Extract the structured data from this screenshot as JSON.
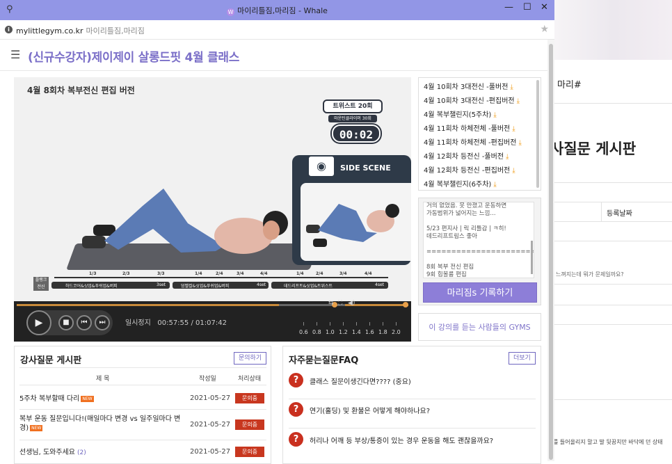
{
  "window": {
    "title": "마이리틀짐,마리짐 - Whale",
    "url": "mylittlegym.co.kr",
    "url_title": "마이리틀짐,마리짐"
  },
  "page": {
    "title": "(신규수강자)제이제이 살롱드핏 4월 클래스"
  },
  "video": {
    "caption": "4월 8회차 복부전신 편집 버전",
    "count_label": "트위스트 20회",
    "count_sub": "마운틴클라이머 30회",
    "timer": "00:02",
    "side_scene": "SIDE SCENE",
    "timeline_label": "플랭크 전신",
    "timeline_marks": [
      "1/3",
      "2/3",
      "3/3",
      "1/4",
      "2/4",
      "3/4",
      "4/4",
      "1/4",
      "2/4",
      "3/4",
      "4/4"
    ],
    "segments": [
      "하드코어&싯업&푸쉬업&버피",
      "3set",
      "덤벨컬&싯업&푸쉬업&버피",
      "4set",
      "데드리프트&싯업&트위스트",
      "4set"
    ],
    "status": "일시정지",
    "time_current": "00:57:55",
    "time_total": "01:07:42",
    "speeds": [
      "0.6",
      "0.8",
      "1.0",
      "1.2",
      "1.4",
      "1.6",
      "1.8",
      "2.0"
    ],
    "progress_fraction": 0.86
  },
  "clips": [
    "4월 10회차 3대전신 -풀버전",
    "4월 10회차 3대전신 -편집버전",
    "4월 복부챌린지(5주차)",
    "4월 11회차 하체전체 -풀버전",
    "4월 11회차 하체전체 -편집버전",
    "4월 12회차 등전신 -풀버전",
    "4월 12회차 등전신 -편집버전",
    "4월 복부챌린지(6주차)"
  ],
  "memo": {
    "text": "거의 없었음. 못 만졌고 운동하면\n가동범위가 넓어지는 느낌...\n\n5/23 편지사 | 릭 리틀감 | ㅋ히!\n데드리프트림스 좋아\n\n=======================\n\n8회 복부 전신 편집\n9회 힙볼륨 편집",
    "button": "마리짐s 기록하기"
  },
  "gyms_link": "이 강의를 듣는 사람들의 GYMS",
  "qa": {
    "title": "강사질문 게시판",
    "ask_button": "문의하기",
    "columns": [
      "제 목",
      "작성일",
      "처리상태"
    ],
    "rows": [
      {
        "title": "5주차 복부할때 다리",
        "new": "NEW",
        "count": "",
        "date": "2021-05-27",
        "status": "문의중"
      },
      {
        "title": "복부 운동 질문입니다!(매일마다 변경 vs 일주일마다 변경)",
        "new": "NEW",
        "count": "",
        "date": "2021-05-27",
        "status": "문의중"
      },
      {
        "title": "선생님, 도와주세요",
        "new": "",
        "count": "(2)",
        "date": "2021-05-27",
        "status": "문의중"
      }
    ]
  },
  "faq": {
    "title": "자주묻는질문FAQ",
    "more_button": "더보기",
    "items": [
      "클래스 질문이생긴다면???? (중요)",
      "연기(홀딩) 및 환불은 어떻게 해야하나요?",
      "허리나 어깨 등 부상/통증이 있는 경우 운동을 해도 괜찮을까요?"
    ]
  },
  "background": {
    "crumb": "마리#",
    "heading": "사질문 게시판",
    "col": "등록날짜",
    "snippet1": "느껴지는데 뭐가 문제일까요?",
    "snippet2": "를 들어올리지 말고 발 뒷꿈치만 바닥에 던 상태"
  },
  "colors": {
    "titlebar": "#9296e6",
    "accent": "#7b6fc8",
    "status_red": "#c8371f"
  }
}
